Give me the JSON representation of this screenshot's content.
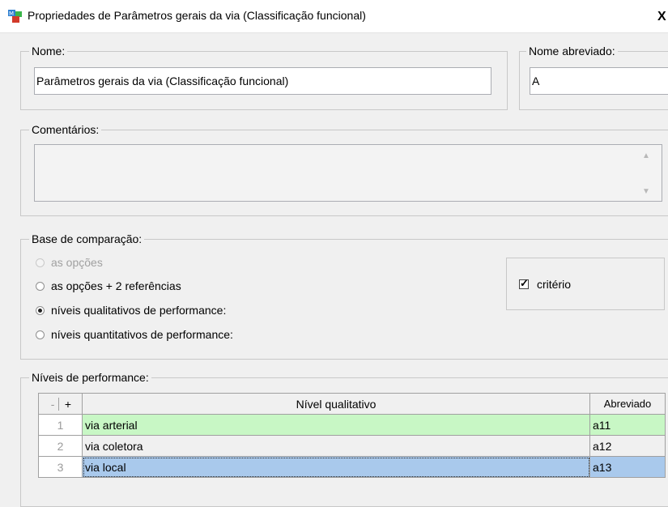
{
  "window": {
    "title": "Propriedades de  Parâmetros gerais da via (Classificação funcional)",
    "close_label": "X"
  },
  "nome": {
    "label": "Nome:",
    "value": "Parâmetros gerais da via (Classificação funcional)"
  },
  "nome_abreviado": {
    "label": "Nome abreviado:",
    "value": "A"
  },
  "comentarios": {
    "label": "Comentários:",
    "value": ""
  },
  "base_comparacao": {
    "label": "Base de comparação:",
    "options": [
      {
        "label": "as opções",
        "checked": false,
        "disabled": true
      },
      {
        "label": "as opções + 2 referências",
        "checked": false,
        "disabled": false
      },
      {
        "label": "níveis qualitativos de performance:",
        "checked": true,
        "disabled": false
      },
      {
        "label": "níveis quantitativos de performance:",
        "checked": false,
        "disabled": false
      }
    ],
    "criterio": {
      "label": "critério",
      "checked": true
    }
  },
  "niveis": {
    "label": "Níveis de performance:",
    "minus_label": "-",
    "plus_label": "+",
    "columns": [
      "Nível qualitativo",
      "Abreviado"
    ],
    "rows": [
      {
        "num": "1",
        "name": "via arterial",
        "abbr": "a11",
        "highlight": "#c8f7c5"
      },
      {
        "num": "2",
        "name": "via coletora",
        "abbr": "a12",
        "highlight": "#ffffff"
      },
      {
        "num": "3",
        "name": "via local",
        "abbr": "a13",
        "highlight": "#a9c9ec"
      }
    ]
  }
}
